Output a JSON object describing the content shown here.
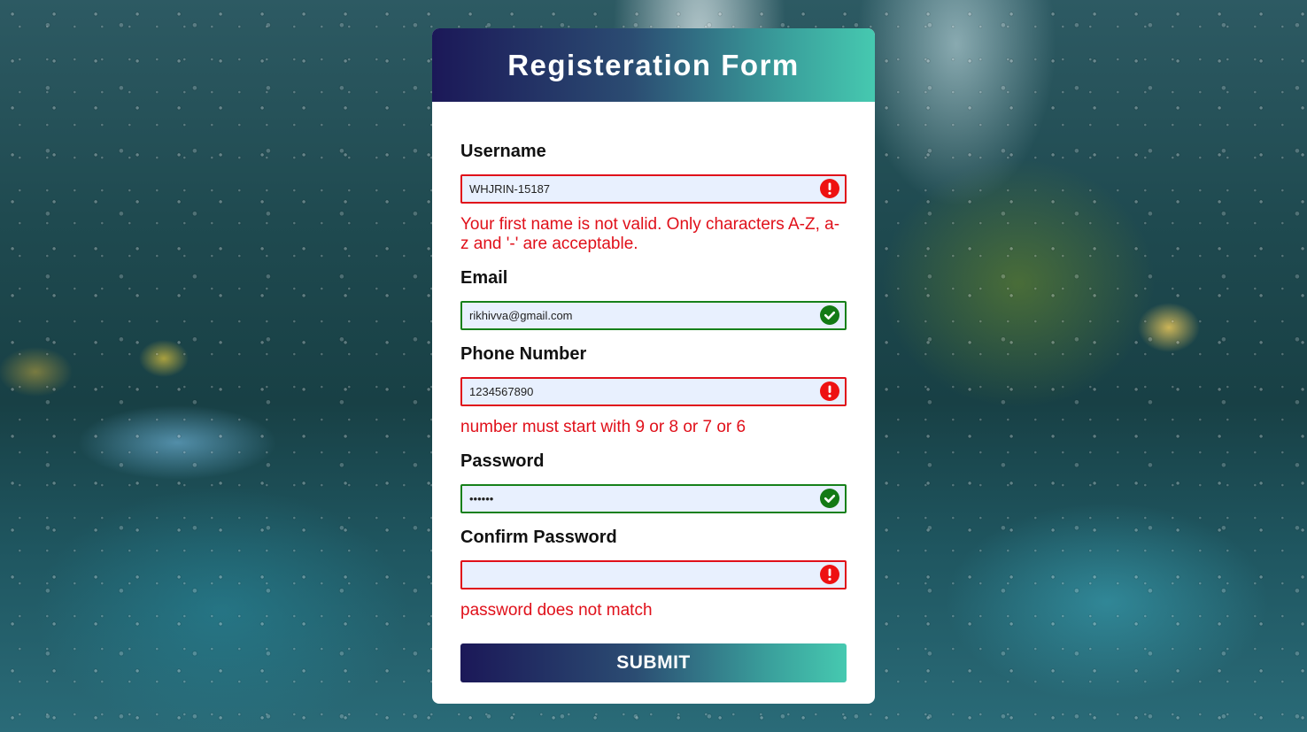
{
  "form": {
    "title": "Registeration Form",
    "fields": [
      {
        "label": "Username",
        "value": "WHJRIN-15187",
        "state": "error",
        "error": "Your first name is not valid. Only characters A-Z, a-z and '-' are acceptable."
      },
      {
        "label": "Email",
        "value": "rikhivva@gmail.com",
        "state": "valid"
      },
      {
        "label": "Phone Number",
        "value": "1234567890",
        "state": "error",
        "error": "number must start with 9 or 8 or 7 or 6"
      },
      {
        "label": "Password",
        "value": "••••••",
        "state": "valid"
      },
      {
        "label": "Confirm Password",
        "value": "",
        "state": "error",
        "error": "password does not match"
      }
    ],
    "submit_label": "SUBMIT"
  },
  "icons": {
    "error": "exclamation-circle-icon",
    "valid": "check-circle-icon"
  },
  "colors": {
    "error": "#e0101a",
    "valid": "#16801a",
    "gradient_start": "#1b1858",
    "gradient_end": "#46c9b0"
  }
}
